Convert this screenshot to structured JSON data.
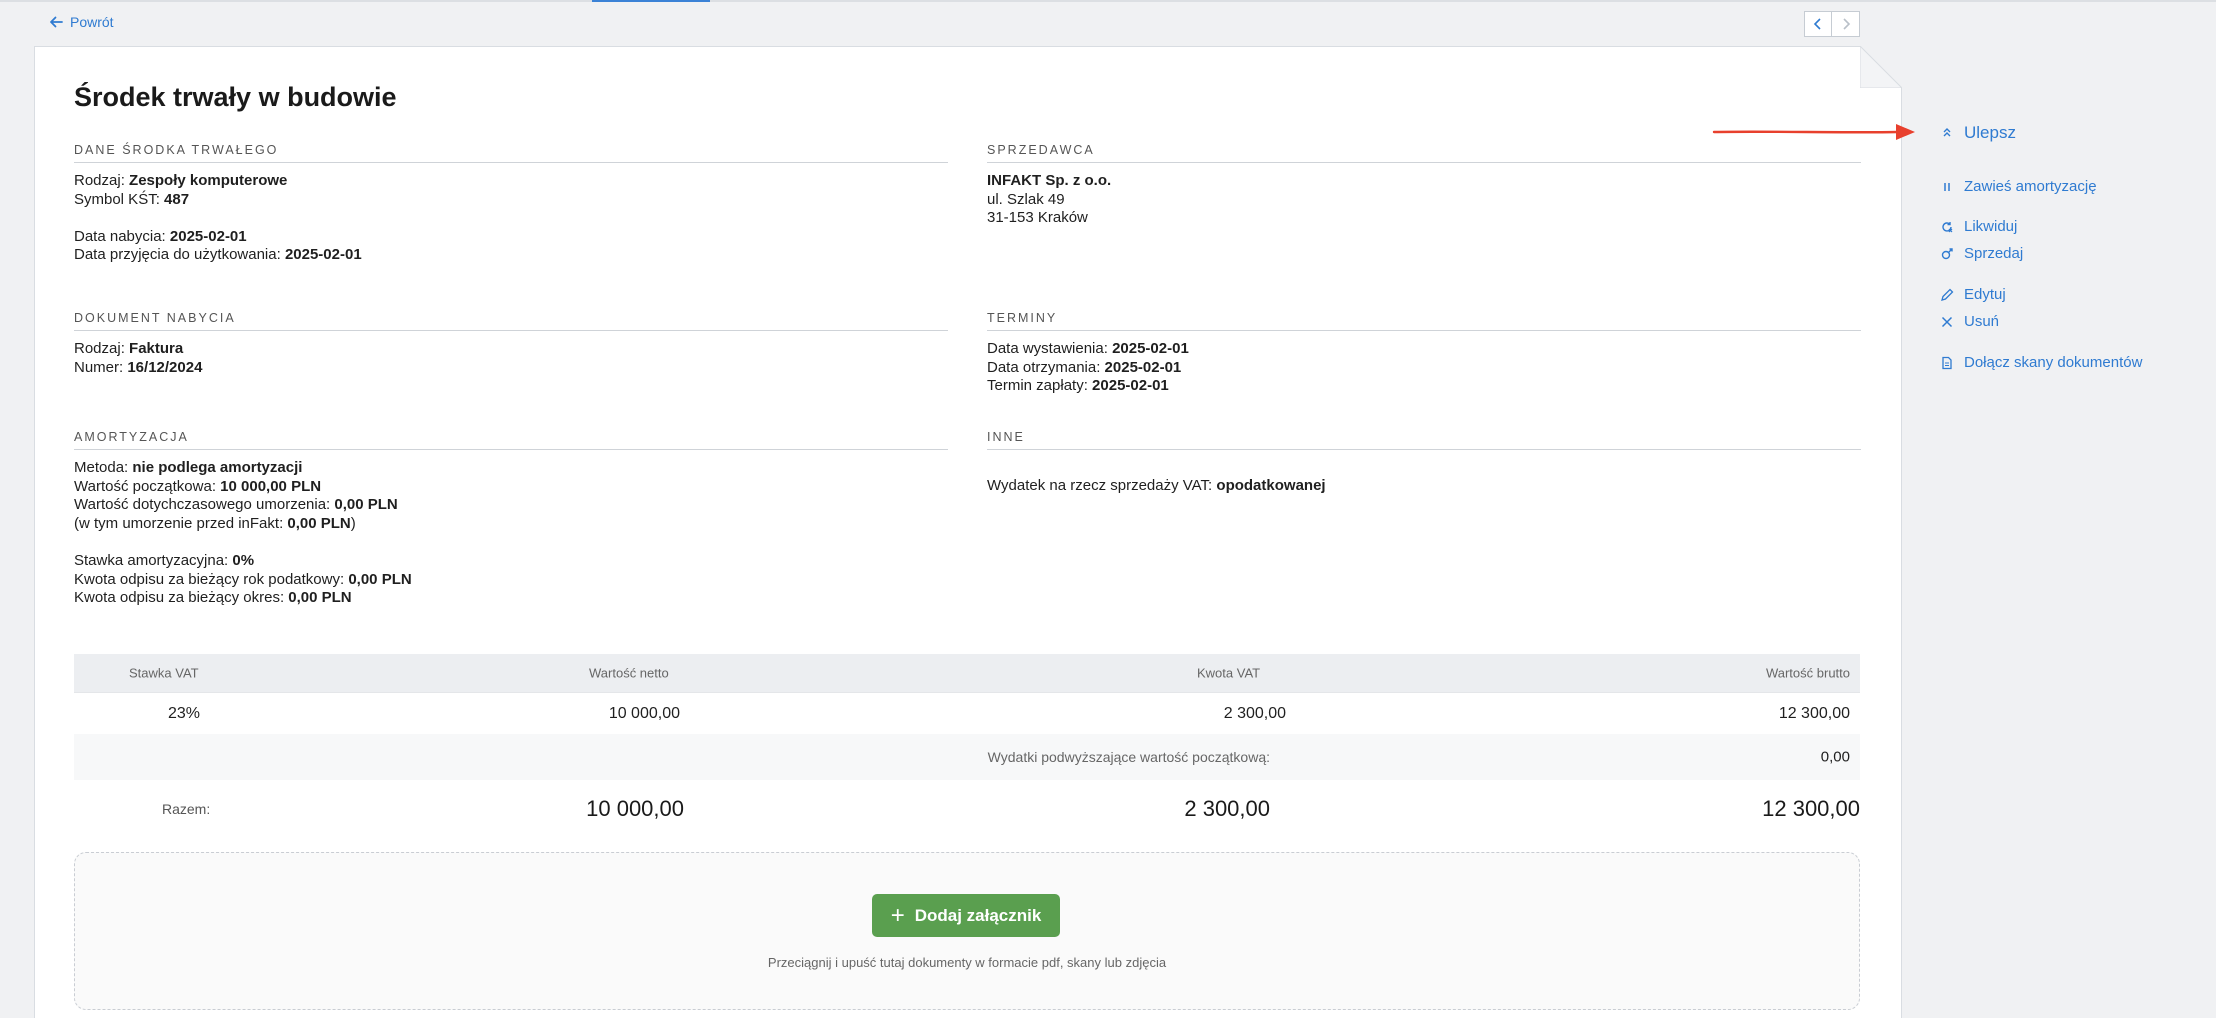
{
  "nav": {
    "back_label": "Powrót"
  },
  "title": "Środek trwały w budowie",
  "sections": {
    "asset": {
      "heading": "DANE ŚRODKA TRWAŁEGO",
      "rows": [
        {
          "label": "Rodzaj: ",
          "value": "Zespoły komputerowe"
        },
        {
          "label": "Symbol KŚT: ",
          "value": "487"
        },
        {
          "label": "Data nabycia: ",
          "value": "2025-02-01"
        },
        {
          "label": "Data przyjęcia do użytkowania: ",
          "value": "2025-02-01"
        }
      ]
    },
    "seller": {
      "heading": "SPRZEDAWCA",
      "name": "INFAKT Sp. z o.o.",
      "street": "ul. Szlak 49",
      "city": "31-153 Kraków"
    },
    "purchase_doc": {
      "heading": "DOKUMENT NABYCIA",
      "rows": [
        {
          "label": "Rodzaj: ",
          "value": "Faktura"
        },
        {
          "label": "Numer: ",
          "value": "16/12/2024"
        }
      ]
    },
    "terms": {
      "heading": "TERMINY",
      "rows": [
        {
          "label": "Data wystawienia: ",
          "value": "2025-02-01"
        },
        {
          "label": "Data otrzymania: ",
          "value": "2025-02-01"
        },
        {
          "label": "Termin zapłaty: ",
          "value": "2025-02-01"
        }
      ]
    },
    "depreciation": {
      "heading": "AMORTYZACJA",
      "rows": [
        {
          "label": "Metoda: ",
          "value": "nie podlega amortyzacji"
        },
        {
          "label": "Wartość początkowa: ",
          "value": "10 000,00 PLN"
        },
        {
          "label": "Wartość dotychczasowego umorzenia: ",
          "value": "0,00 PLN"
        },
        {
          "label": "(w tym umorzenie przed inFakt: ",
          "value": "0,00 PLN",
          "suffix": ")"
        },
        {
          "label": "Stawka amortyzacyjna: ",
          "value": "0%"
        },
        {
          "label": "Kwota odpisu za bieżący rok podatkowy: ",
          "value": "0,00 PLN"
        },
        {
          "label": "Kwota odpisu za bieżący okres: ",
          "value": "0,00 PLN"
        }
      ]
    },
    "other": {
      "heading": "INNE",
      "rows": [
        {
          "label": "Wydatek na rzecz sprzedaży VAT: ",
          "value": "opodatkowanej"
        }
      ]
    }
  },
  "vat_table": {
    "headers": [
      "Stawka VAT",
      "Wartość netto",
      "Kwota VAT",
      "Wartość brutto"
    ],
    "row": {
      "rate": "23%",
      "net": "10 000,00",
      "vat": "2 300,00",
      "gross": "12 300,00"
    },
    "extra_label": "Wydatki podwyższające wartość początkową:",
    "extra_value": "0,00",
    "total_label": "Razem:",
    "total": {
      "net": "10 000,00",
      "vat": "2 300,00",
      "gross": "12 300,00"
    }
  },
  "attachments": {
    "button_label": "Dodaj załącznik",
    "hint": "Przeciągnij i upuść tutaj dokumenty w formacie pdf, skany lub zdjęcia"
  },
  "actions": {
    "upgrade": "Ulepsz",
    "suspend": "Zawieś amortyzację",
    "liquidate": "Likwiduj",
    "sell": "Sprzedaj",
    "edit": "Edytuj",
    "delete": "Usuń",
    "attach_scans": "Dołącz skany dokumentów"
  },
  "colors": {
    "link": "#2f7bd1",
    "primary_button": "#5a9f4f",
    "annotation_arrow": "#e8402d"
  }
}
